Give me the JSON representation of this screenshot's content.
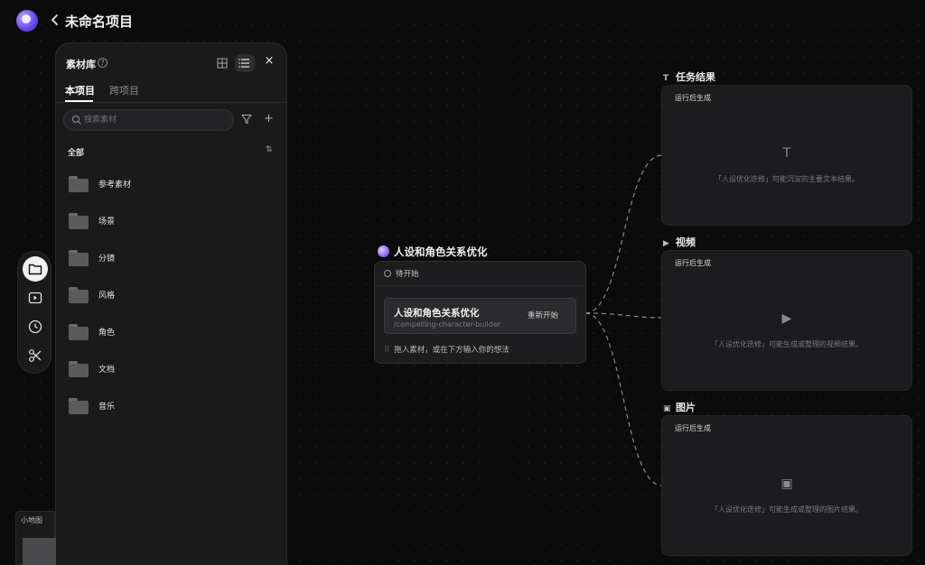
{
  "app": {
    "project_title": "未命名项目"
  },
  "rail": {
    "items": [
      {
        "icon": "folder-icon",
        "active": true
      },
      {
        "icon": "video-icon",
        "active": false
      },
      {
        "icon": "clock-icon",
        "active": false
      },
      {
        "icon": "scissors-icon",
        "active": false
      }
    ]
  },
  "library": {
    "title": "素材库",
    "help": "?",
    "close": "×",
    "tabs": [
      {
        "label": "本项目",
        "active": true
      },
      {
        "label": "跨项目",
        "active": false
      }
    ],
    "search_placeholder": "搜索素材",
    "add": "+",
    "section_label": "全部",
    "sort": "⇅",
    "folders": [
      "参考素材",
      "场景",
      "分镜",
      "风格",
      "角色",
      "文档",
      "音乐"
    ]
  },
  "node": {
    "title": "人设和角色关系优化",
    "status": "待开始",
    "skill_name": "人设和角色关系优化",
    "skill_slug": "/compelling-character-builder",
    "restart_label": "重新开始",
    "drop_hint": "拖入素材，或在下方输入你的想法"
  },
  "outputs": [
    {
      "head_icon": "T",
      "title": "任务结果",
      "tag": "运行后生成",
      "center_icon": "T",
      "desc": "「人设优化迭修」可能沉淀的主要文本结果。"
    },
    {
      "head_icon": "▶",
      "title": "视频",
      "tag": "运行后生成",
      "center_icon": "▶",
      "desc": "「人设优化迭修」可能生成或整理的视频结果。"
    },
    {
      "head_icon": "▣",
      "title": "图片",
      "tag": "运行后生成",
      "center_icon": "▣",
      "desc": "「人设优化迭修」可能生成或整理的图片结果。"
    }
  ],
  "minimap": {
    "label": "小地图"
  }
}
